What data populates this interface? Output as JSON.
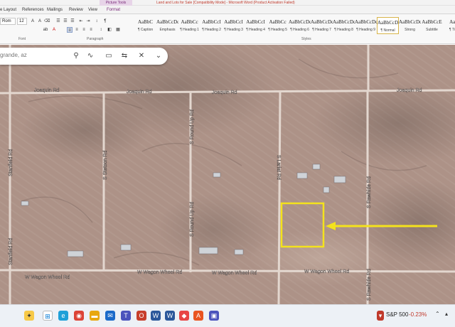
{
  "title_bar": {
    "contextual_tab": "Picture Tools",
    "document_title": "Land and Lots for Sale [Compatibility Mode] - Microsoft Word (Product Activation Failed)"
  },
  "ribbon_tabs": [
    "e Layout",
    "References",
    "Mailings",
    "Review",
    "View",
    "Format"
  ],
  "ribbon": {
    "font_name": "Rom",
    "font_size": "12",
    "group_labels": {
      "font": "Font",
      "paragraph": "Paragraph",
      "styles": "Styles"
    },
    "styles": [
      {
        "preview": "AaBbC",
        "name": "¶ Caption"
      },
      {
        "preview": "AaBbCcDc",
        "name": "Emphasis"
      },
      {
        "preview": "AaBbCc",
        "name": "¶ Heading 1"
      },
      {
        "preview": "AaBbCcI",
        "name": "¶ Heading 2"
      },
      {
        "preview": "AaBbCcI",
        "name": "¶ Heading 3"
      },
      {
        "preview": "AaBbCcI",
        "name": "¶ Heading 4"
      },
      {
        "preview": "AaBbCc",
        "name": "¶ Heading 5"
      },
      {
        "preview": "AaBbCcDc",
        "name": "¶ Heading 6"
      },
      {
        "preview": "AaBbCcDc",
        "name": "¶ Heading 7"
      },
      {
        "preview": "AaBbCcDc",
        "name": "¶ Heading 8"
      },
      {
        "preview": "AaBbCcDc",
        "name": "¶ Heading 9"
      },
      {
        "preview": "AaBbCcDc",
        "name": "¶ Normal"
      },
      {
        "preview": "AaBbCcDd",
        "name": "Strong"
      },
      {
        "preview": "AaBbCcE",
        "name": "Subtitle"
      },
      {
        "preview": "AaB",
        "name": "¶ Title"
      }
    ],
    "selected_style": "¶ Normal"
  },
  "map": {
    "search_text": "grande, az",
    "road_labels": {
      "joaquin_west": "Joaquin Rd",
      "joaquin_mid": "Joaquin Rd",
      "joaquin_center": "Joaquin Rd",
      "joaquin_east": "Joaquin Rd",
      "stanfield_west": "Stanfield Rd",
      "stanfield_west2": "Stanfield Rd",
      "stetson": "S Stetson Rd",
      "round_up_north": "S Round Up Rd",
      "round_up_south": "S Round Up Rd",
      "lariat": "S Lariat Rd",
      "rawhide": "S Rawhide Rd",
      "rawhide_south": "S Rawhide Rd",
      "wagon_west": "W Wagon Wheel Rd",
      "wagon_mid": "W Wagon Wheel Rd",
      "wagon_center": "W Wagon Wheel Rd",
      "wagon_east": "W Wagon Wheel Rd"
    },
    "highlight_color": "#f4e21c"
  },
  "taskbar": {
    "stock_name": "S&P 500",
    "stock_change": "-0.23%"
  },
  "icons": [
    "location-pin-icon",
    "route-icon",
    "directions-icon",
    "measure-icon",
    "more-icon",
    "chevron-down-icon"
  ]
}
